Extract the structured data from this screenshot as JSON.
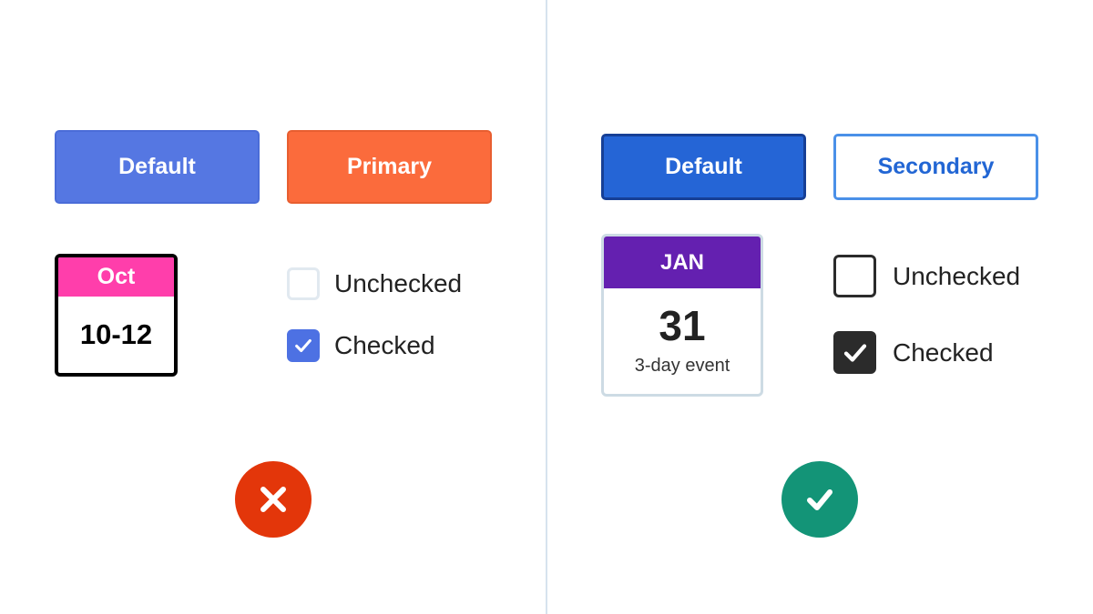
{
  "bad_example": {
    "buttons": {
      "default_label": "Default",
      "primary_label": "Primary"
    },
    "calendar": {
      "month": "Oct",
      "range": "10-12"
    },
    "checkboxes": {
      "unchecked_label": "Unchecked",
      "checked_label": "Checked"
    },
    "status_icon": "x-mark-icon",
    "colors": {
      "default_button": "#5577e2",
      "primary_button": "#fb6b3c",
      "calendar_header": "#ff3eab",
      "status": "#e3360a"
    }
  },
  "good_example": {
    "buttons": {
      "default_label": "Default",
      "secondary_label": "Secondary"
    },
    "calendar": {
      "month": "JAN",
      "day": "31",
      "note": "3-day event"
    },
    "checkboxes": {
      "unchecked_label": "Unchecked",
      "checked_label": "Checked"
    },
    "status_icon": "checkmark-icon",
    "colors": {
      "default_button": "#2565d6",
      "secondary_border": "#4a90e8",
      "calendar_header": "#6420b0",
      "status": "#139477"
    }
  }
}
